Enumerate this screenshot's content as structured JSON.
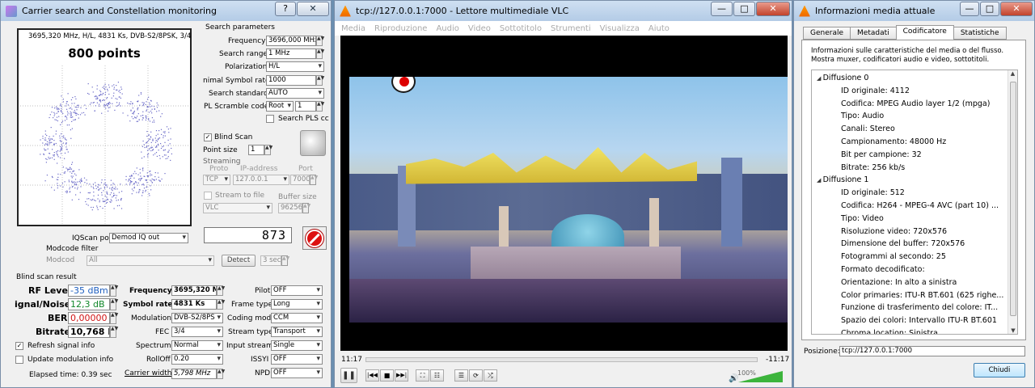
{
  "carrier": {
    "title": "Carrier search and Constellation monitoring",
    "header_line": "3695,320 MHz, H/L, 4831 Ks, DVB-S2/8PSK, 3/4",
    "points_label": "800 points",
    "search_params": {
      "group": "Search parameters",
      "frequency_label": "Frequency",
      "frequency_value": "3696,000 MHz",
      "range_label": "Search range",
      "range_value": "1 MHz",
      "polar_label": "Polarization",
      "polar_value": "H/L",
      "symrate_label": "nimal Symbol rate",
      "symrate_value": "1000",
      "standard_label": "Search standard",
      "standard_value": "AUTO",
      "scramble_label": "PL Scramble code",
      "scramble_value": "Root",
      "scramble_num": "1",
      "pls_label": "Search PLS cc"
    },
    "blind_scan_label": "Blind Scan",
    "point_size_label": "Point size",
    "point_size_value": "1",
    "streaming": {
      "label": "Streaming",
      "proto_hdr": "Proto",
      "ip_hdr": "IP-address",
      "port_hdr": "Port",
      "proto": "TCP",
      "ip": "127.0.0.1",
      "port": "7000",
      "stream_file_label": "Stream to file",
      "buffer_label": "Buffer size",
      "player": "VLC",
      "buffer": "96256"
    },
    "counter": "873",
    "iq_label": "IQScan point",
    "iq_value": "Demod IQ out",
    "modcode_filter_label": "Modcode filter",
    "modcode_label": "Modcod",
    "modcode_value": "All",
    "detect_label": "Detect",
    "detect_value": "3 sec",
    "result_title": "Blind scan result",
    "rf_label": "RF Level",
    "rf_value": "-35 dBm",
    "sn_label": "ignal/Noise",
    "sn_value": "12,3 dB",
    "ber_label": "BER",
    "ber_value": "0,00000",
    "bitrate_label": "Bitrate",
    "bitrate_value": "10,768 M",
    "freq_label": "Frequency",
    "freq_value": "3695,320 M",
    "sym_label": "Symbol rate",
    "sym_value": "4831 Ks",
    "mod_label": "Modulation",
    "mod_value": "DVB-S2/8PS",
    "fec_label": "FEC",
    "fec_value": "3/4",
    "spectrum_label": "Spectrum",
    "spectrum_value": "Normal",
    "rolloff_label": "RollOff",
    "rolloff_value": "0.20",
    "cw_label": "Carrier width",
    "cw_value": "5,798 MHz",
    "pilot_label": "Pilot",
    "pilot_value": "OFF",
    "frame_label": "Frame type",
    "frame_value": "Long",
    "coding_label": "Coding mode",
    "coding_value": "CCM",
    "stype_label": "Stream type",
    "stype_value": "Transport",
    "istream_label": "Input stream",
    "istream_value": "Single",
    "issyi_label": "ISSYI",
    "issyi_value": "OFF",
    "npd_label": "NPD",
    "npd_value": "OFF",
    "refresh_label": "Refresh signal info",
    "update_label": "Update modulation info",
    "elapsed": "Elapsed time: 0.39 sec"
  },
  "vlc": {
    "title": "tcp://127.0.0.1:7000 - Lettore multimediale VLC",
    "menu": [
      "Media",
      "Riproduzione",
      "Audio",
      "Video",
      "Sottotitolo",
      "Strumenti",
      "Visualizza",
      "Aiuto"
    ],
    "time_elapsed": "11:17",
    "time_remaining": "-11:17",
    "volume": "100%",
    "volume_level": 1.0,
    "seek_fraction": 0.0
  },
  "info": {
    "title": "Informazioni media attuale",
    "tabs": [
      "Generale",
      "Metadati",
      "Codificatore",
      "Statistiche"
    ],
    "active_tab": "Codificatore",
    "desc": "Informazioni sulle caratteristiche del media o del flusso. Mostra muxer, codificatori audio e video, sottotitoli.",
    "tree": [
      {
        "level": 0,
        "text": "Diffusione 0"
      },
      {
        "level": 1,
        "text": "ID originale: 4112"
      },
      {
        "level": 1,
        "text": "Codifica: MPEG Audio layer 1/2 (mpga)"
      },
      {
        "level": 1,
        "text": "Tipo: Audio"
      },
      {
        "level": 1,
        "text": "Canali: Stereo"
      },
      {
        "level": 1,
        "text": "Campionamento: 48000 Hz"
      },
      {
        "level": 1,
        "text": "Bit per campione: 32"
      },
      {
        "level": 1,
        "text": "Bitrate: 256 kb/s"
      },
      {
        "level": 0,
        "text": "Diffusione 1"
      },
      {
        "level": 1,
        "text": "ID originale: 512"
      },
      {
        "level": 1,
        "text": "Codifica: H264 - MPEG-4 AVC (part 10) ..."
      },
      {
        "level": 1,
        "text": "Tipo: Video"
      },
      {
        "level": 1,
        "text": "Risoluzione video: 720x576"
      },
      {
        "level": 1,
        "text": "Dimensione del buffer: 720x576"
      },
      {
        "level": 1,
        "text": "Fotogrammi al secondo: 25"
      },
      {
        "level": 1,
        "text": "Formato decodificato:"
      },
      {
        "level": 1,
        "text": "Orientazione: In alto a sinistra"
      },
      {
        "level": 1,
        "text": "Color primaries: ITU-R BT.601 (625 righe..."
      },
      {
        "level": 1,
        "text": "Funzione di trasferimento del colore: IT..."
      },
      {
        "level": 1,
        "text": "Spazio dei colori: Intervallo ITU-R BT.601"
      },
      {
        "level": 1,
        "text": "Chroma location: Sinistra"
      }
    ],
    "position_label": "Posizione:",
    "position_value": "tcp://127.0.0.1:7000",
    "close_label": "Chiudi"
  }
}
